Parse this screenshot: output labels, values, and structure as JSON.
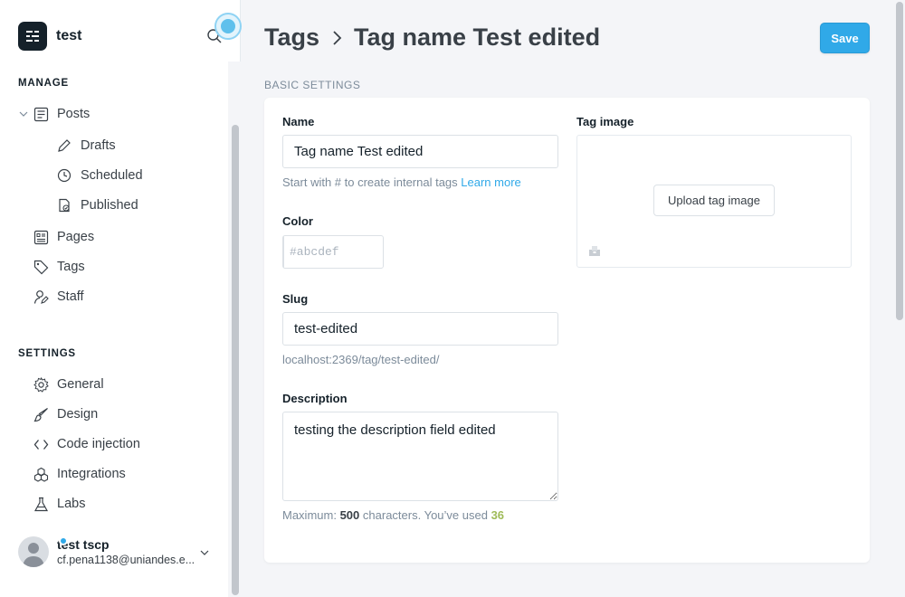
{
  "app": {
    "site_name": "test"
  },
  "sidebar": {
    "manage_title": "MANAGE",
    "settings_title": "SETTINGS",
    "manage_items": [
      {
        "label": "Posts",
        "icon": "posts-icon"
      },
      {
        "label": "Drafts",
        "icon": "pencil-icon"
      },
      {
        "label": "Scheduled",
        "icon": "clock-icon"
      },
      {
        "label": "Published",
        "icon": "published-icon"
      },
      {
        "label": "Pages",
        "icon": "pages-icon"
      },
      {
        "label": "Tags",
        "icon": "tag-icon"
      },
      {
        "label": "Staff",
        "icon": "staff-icon"
      }
    ],
    "settings_items": [
      {
        "label": "General",
        "icon": "gear-icon"
      },
      {
        "label": "Design",
        "icon": "brush-icon"
      },
      {
        "label": "Code injection",
        "icon": "code-icon"
      },
      {
        "label": "Integrations",
        "icon": "integrations-icon"
      },
      {
        "label": "Labs",
        "icon": "flask-icon"
      }
    ],
    "user": {
      "name": "test tscp",
      "email": "cf.pena1138@uniandes.e..."
    }
  },
  "header": {
    "breadcrumb_root": "Tags",
    "breadcrumb_current": "Tag name Test edited",
    "save_label": "Save"
  },
  "form": {
    "section_label": "BASIC SETTINGS",
    "name_label": "Name",
    "name_value": "Tag name Test edited",
    "name_hint": "Start with # to create internal tags",
    "name_hint_link": "Learn more",
    "color_label": "Color",
    "color_placeholder": "#abcdef",
    "slug_label": "Slug",
    "slug_value": "test-edited",
    "slug_url": "localhost:2369/tag/test-edited/",
    "description_label": "Description",
    "description_value": "testing the description field edited",
    "description_hint_prefix": "Maximum:",
    "description_max": "500",
    "description_hint_middle": "characters. You’ve used",
    "description_used": "36",
    "image_label": "Tag image",
    "upload_label": "Upload tag image"
  },
  "colors": {
    "accent": "#30a9e8",
    "count_green": "#9fbb58",
    "text_dark": "#15212a"
  }
}
